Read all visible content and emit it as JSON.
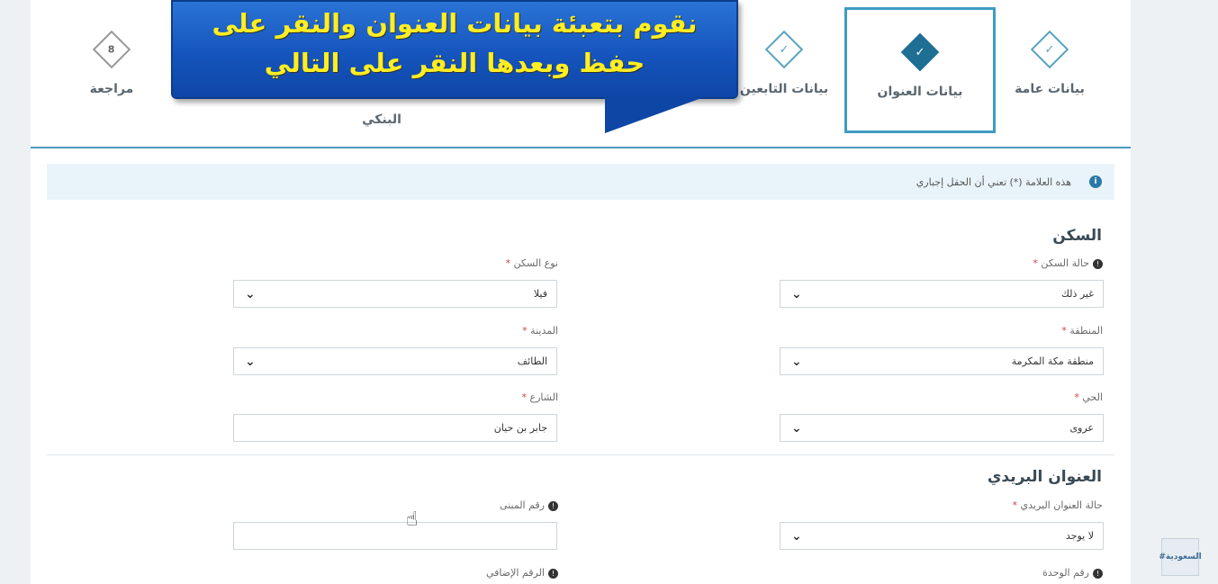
{
  "callout": {
    "line1": "نقوم بتعبئة بيانات العنوان والنقر على",
    "line2": "حفظ وبعدها النقر على التالي"
  },
  "stepper": {
    "steps": [
      {
        "label": "بيانات عامة",
        "icon": "check",
        "state": "done"
      },
      {
        "label": "بيانات العنوان",
        "icon": "check",
        "state": "active"
      },
      {
        "label": "بيانات التابعين",
        "icon": "check",
        "state": "done"
      },
      {
        "label": "البنكي",
        "icon": "",
        "state": "hidden"
      },
      {
        "label": "مراجعة",
        "icon": "8",
        "state": "pending"
      }
    ]
  },
  "info": {
    "icon": "info-icon",
    "text": "هذه العلامة (*) تعني أن الحقل إجباري"
  },
  "housing": {
    "title": "السكن",
    "housing_status_label": "حالة السكن",
    "housing_status_value": "غير ذلك",
    "housing_type_label": "نوع السكن",
    "housing_type_value": "فيلا",
    "region_label": "المنطقة",
    "region_value": "منطقة مكة المكرمة",
    "city_label": "المدينة",
    "city_value": "الطائف",
    "district_label": "الحي",
    "district_value": "عروى",
    "street_label": "الشارع",
    "street_value": "جابر بن حيان"
  },
  "postal": {
    "title": "العنوان البريدي",
    "postal_status_label": "حالة العنوان البريدي",
    "postal_status_value": "لا يوجد",
    "building_no_label": "رقم المبنى",
    "building_no_value": "",
    "unit_no_label": "رقم الوحدة",
    "additional_no_label": "الرقم الإضافي"
  },
  "required_mark": "*",
  "badge_text": "#السعودية"
}
